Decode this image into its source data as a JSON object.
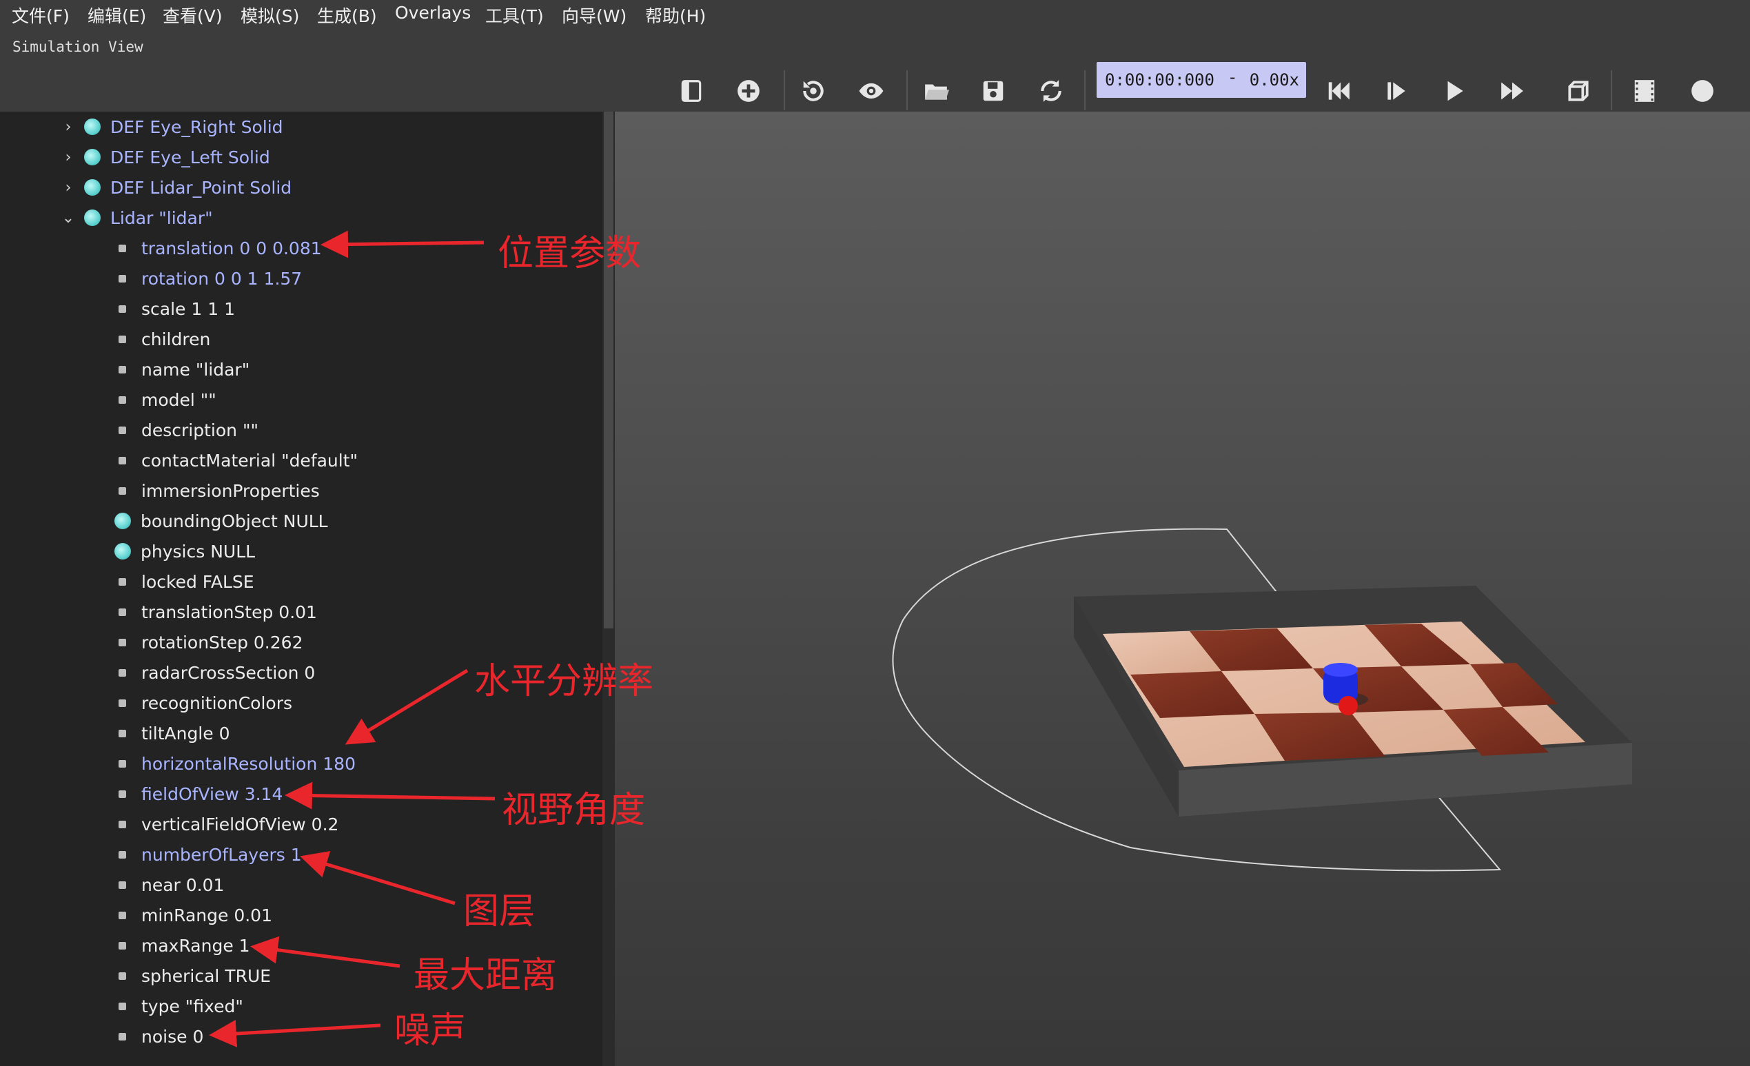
{
  "menu": [
    "文件(F)",
    "编辑(E)",
    "查看(V)",
    "模拟(S)",
    "生成(B)",
    "Overlays",
    "工具(T)",
    "向导(W)",
    "帮助(H)"
  ],
  "view_title": "Simulation View",
  "toolbar": {
    "icons": [
      "panel-toggle-icon",
      "add-node-icon",
      "reset-view-icon",
      "eye-icon",
      "open-folder-icon",
      "save-icon",
      "reload-icon",
      "step-back-icon",
      "step-icon",
      "play-icon",
      "fast-forward-icon",
      "3d-view-icon",
      "movie-icon",
      "record-icon"
    ],
    "time": "0:00:00:000",
    "time_sep": "-",
    "speed": "0.00x"
  },
  "tree": [
    {
      "label": "DEF Eye_Right Solid",
      "kind": "node",
      "expand": "collapsed",
      "depth": 0
    },
    {
      "label": "DEF Eye_Left Solid",
      "kind": "node",
      "expand": "collapsed",
      "depth": 0
    },
    {
      "label": "DEF Lidar_Point Solid",
      "kind": "node",
      "expand": "collapsed",
      "depth": 0
    },
    {
      "label": "Lidar \"lidar\"",
      "kind": "node",
      "expand": "expanded",
      "depth": 0
    },
    {
      "label": "translation 0 0 0.081",
      "kind": "field",
      "modified": true
    },
    {
      "label": "rotation 0 0 1 1.57",
      "kind": "field",
      "modified": true
    },
    {
      "label": "scale 1 1 1",
      "kind": "field",
      "modified": false
    },
    {
      "label": "children",
      "kind": "field",
      "modified": false
    },
    {
      "label": "name \"lidar\"",
      "kind": "field",
      "modified": false
    },
    {
      "label": "model \"\"",
      "kind": "field",
      "modified": false
    },
    {
      "label": "description \"\"",
      "kind": "field",
      "modified": false
    },
    {
      "label": "contactMaterial \"default\"",
      "kind": "field",
      "modified": false
    },
    {
      "label": "immersionProperties",
      "kind": "field",
      "modified": false
    },
    {
      "label": "boundingObject NULL",
      "kind": "nodefield",
      "modified": false
    },
    {
      "label": "physics NULL",
      "kind": "nodefield",
      "modified": false
    },
    {
      "label": "locked FALSE",
      "kind": "field",
      "modified": false
    },
    {
      "label": "translationStep 0.01",
      "kind": "field",
      "modified": false
    },
    {
      "label": "rotationStep 0.262",
      "kind": "field",
      "modified": false
    },
    {
      "label": "radarCrossSection 0",
      "kind": "field",
      "modified": false
    },
    {
      "label": "recognitionColors",
      "kind": "field",
      "modified": false
    },
    {
      "label": "tiltAngle 0",
      "kind": "field",
      "modified": false
    },
    {
      "label": "horizontalResolution 180",
      "kind": "field",
      "modified": true
    },
    {
      "label": "fieldOfView 3.14",
      "kind": "field",
      "modified": true
    },
    {
      "label": "verticalFieldOfView 0.2",
      "kind": "field",
      "modified": false
    },
    {
      "label": "numberOfLayers 1",
      "kind": "field",
      "modified": true
    },
    {
      "label": "near 0.01",
      "kind": "field",
      "modified": false
    },
    {
      "label": "minRange 0.01",
      "kind": "field",
      "modified": false
    },
    {
      "label": "maxRange 1",
      "kind": "field",
      "modified": false
    },
    {
      "label": "spherical TRUE",
      "kind": "field",
      "modified": false
    },
    {
      "label": "type \"fixed\"",
      "kind": "field",
      "modified": false
    },
    {
      "label": "noise 0",
      "kind": "field",
      "modified": false
    }
  ],
  "annotations": [
    "位置参数",
    "水平分辨率",
    "视野角度",
    "图层",
    "最大距离",
    "噪声"
  ],
  "colors": {
    "annotation": "#e8262c",
    "modified_field": "#a9b4ff",
    "time_bg": "#c8c8f5"
  }
}
